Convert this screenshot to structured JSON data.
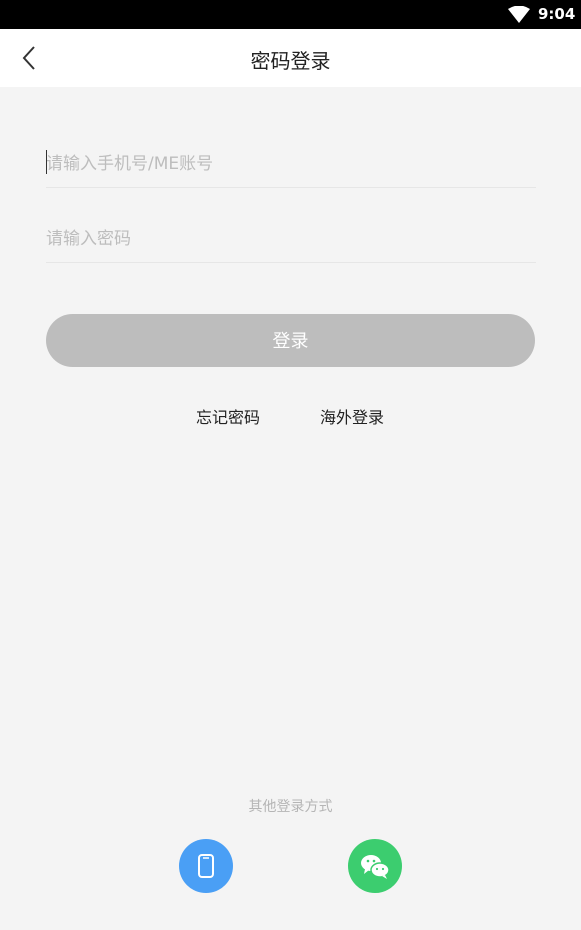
{
  "status_bar": {
    "time": "9:04",
    "icons": [
      "wifi-icon"
    ]
  },
  "nav": {
    "title": "密码登录",
    "back_icon": "back-arrow-icon"
  },
  "form": {
    "phone_placeholder": "请输入手机号/ME账号",
    "password_placeholder": "请输入密码",
    "login_label": "登录"
  },
  "links": {
    "forgot": "忘记密码",
    "overseas": "海外登录"
  },
  "other": {
    "label": "其他登录方式",
    "options": [
      {
        "name": "phone-login",
        "icon": "phone-icon",
        "color": "#4a9ff5"
      },
      {
        "name": "wechat-login",
        "icon": "wechat-icon",
        "color": "#3ccd6f"
      }
    ]
  },
  "colors": {
    "button_disabled": "#bdbdbd",
    "background": "#f4f4f4"
  }
}
